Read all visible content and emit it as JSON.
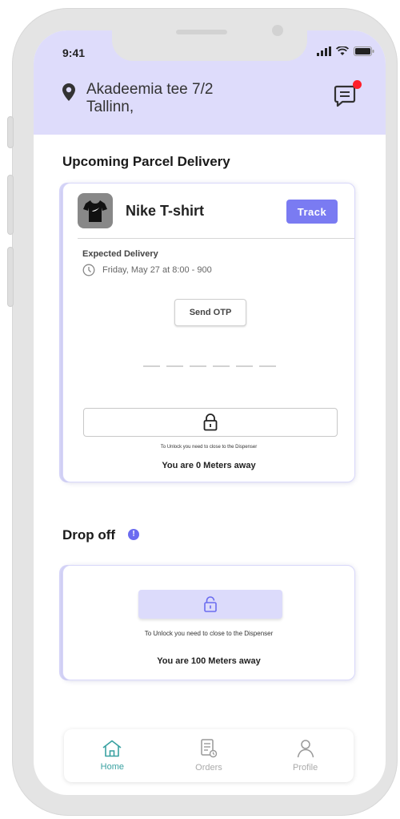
{
  "status_bar": {
    "time": "9:41"
  },
  "header": {
    "address_line1": "Akadeemia tee 7/2",
    "address_line2": "Tallinn,",
    "has_notification": true
  },
  "upcoming": {
    "section_title": "Upcoming Parcel Delivery",
    "product_name": "Nike T-shirt",
    "track_label": "Track",
    "expected_label": "Expected Delivery",
    "expected_time": "Friday, May 27 at 8:00 - 900",
    "send_otp_label": "Send OTP",
    "otp_length": 6,
    "unlock_note": "To Unlock you need to close to the Dispenser",
    "distance_text": "You are 0 Meters away"
  },
  "dropoff": {
    "section_title": "Drop off",
    "info_icon_glyph": "!",
    "unlock_note": "To Unlock you need to close to the Dispenser",
    "distance_text": "You are 100 Meters away"
  },
  "nav": {
    "items": [
      {
        "label": "Home",
        "icon": "home-icon",
        "active": true
      },
      {
        "label": "Orders",
        "icon": "orders-icon",
        "active": false
      },
      {
        "label": "Profile",
        "icon": "profile-icon",
        "active": false
      }
    ]
  },
  "colors": {
    "accent": "#7a7bf2",
    "header_bg": "#dedcfb",
    "active_nav": "#39a1a1",
    "notification": "#ff1f2a"
  }
}
